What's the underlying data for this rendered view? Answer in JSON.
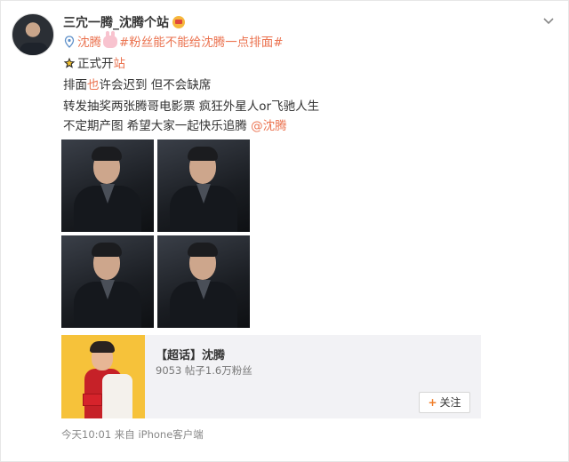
{
  "post": {
    "username": "三宂一腾_沈腾个站",
    "tag_name": "沈腾",
    "hashtag": "#粉丝能不能给沈腾一点排面#",
    "announce_prefix": "正式开",
    "announce_suffix": "站",
    "line_a_1": "排面",
    "line_a_2": "也",
    "line_a_3": "许会迟到 但不会缺席",
    "line_b": "转发抽奖两张腾哥电影票 疯狂外星人or飞驰人生",
    "line_c": "不定期产图 希望大家一起快乐追腾 ",
    "mention": "@沈腾"
  },
  "topic": {
    "title": "【超话】沈腾",
    "stats": "9053 帖子1.6万粉丝",
    "follow_label": "关注",
    "follow_plus": "+"
  },
  "meta": {
    "time_source": "今天10:01 来自 iPhone客户端"
  },
  "icons": {
    "more": "chevron-down-icon",
    "crown": "crown-icon",
    "bunny": "bunny-icon",
    "star": "star-icon",
    "location": "location-icon"
  },
  "colors": {
    "link": "#eb7350",
    "follow_plus": "#f07d29"
  }
}
